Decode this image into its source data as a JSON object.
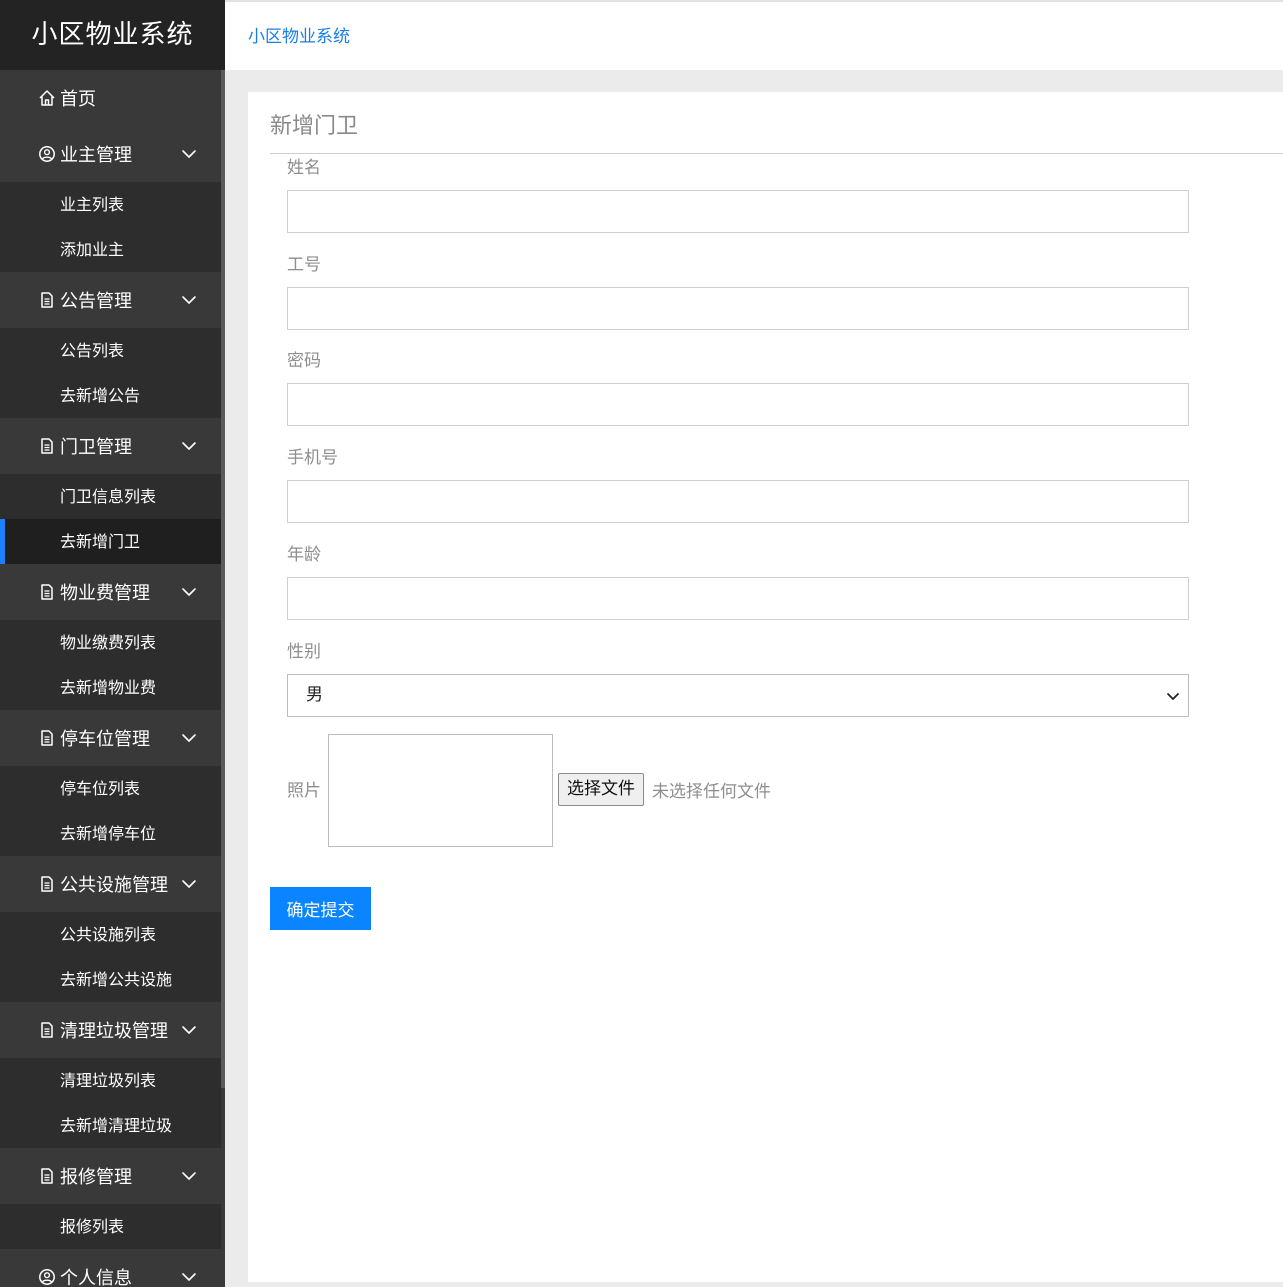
{
  "app": {
    "logo": "小区物业系统",
    "breadcrumb": "小区物业系统"
  },
  "sidebar": {
    "home": "首页",
    "groups": [
      {
        "label": "业主管理",
        "icon": "user-circle-icon",
        "items": [
          "业主列表",
          "添加业主"
        ]
      },
      {
        "label": "公告管理",
        "icon": "document-icon",
        "items": [
          "公告列表",
          "去新增公告"
        ]
      },
      {
        "label": "门卫管理",
        "icon": "document-icon",
        "items": [
          "门卫信息列表",
          "去新增门卫"
        ]
      },
      {
        "label": "物业费管理",
        "icon": "document-icon",
        "items": [
          "物业缴费列表",
          "去新增物业费"
        ]
      },
      {
        "label": "停车位管理",
        "icon": "document-icon",
        "items": [
          "停车位列表",
          "去新增停车位"
        ]
      },
      {
        "label": "公共设施管理",
        "icon": "document-icon",
        "items": [
          "公共设施列表",
          "去新增公共设施"
        ]
      },
      {
        "label": "清理垃圾管理",
        "icon": "document-icon",
        "items": [
          "清理垃圾列表",
          "去新增清理垃圾"
        ]
      },
      {
        "label": "报修管理",
        "icon": "document-icon",
        "items": [
          "报修列表"
        ]
      },
      {
        "label": "个人信息",
        "icon": "user-circle-icon",
        "items": []
      }
    ],
    "active_item": "去新增门卫",
    "accent_color": "#1e80ff"
  },
  "form": {
    "title": "新增门卫",
    "fields": [
      {
        "label": "姓名",
        "value": ""
      },
      {
        "label": "工号",
        "value": ""
      },
      {
        "label": "密码",
        "value": ""
      },
      {
        "label": "手机号",
        "value": ""
      },
      {
        "label": "年龄",
        "value": ""
      }
    ],
    "gender": {
      "label": "性别",
      "selected": "男"
    },
    "photo": {
      "label": "照片",
      "button": "选择文件",
      "status": "未选择任何文件"
    },
    "submit": "确定提交",
    "submit_color": "#0b84ff"
  }
}
